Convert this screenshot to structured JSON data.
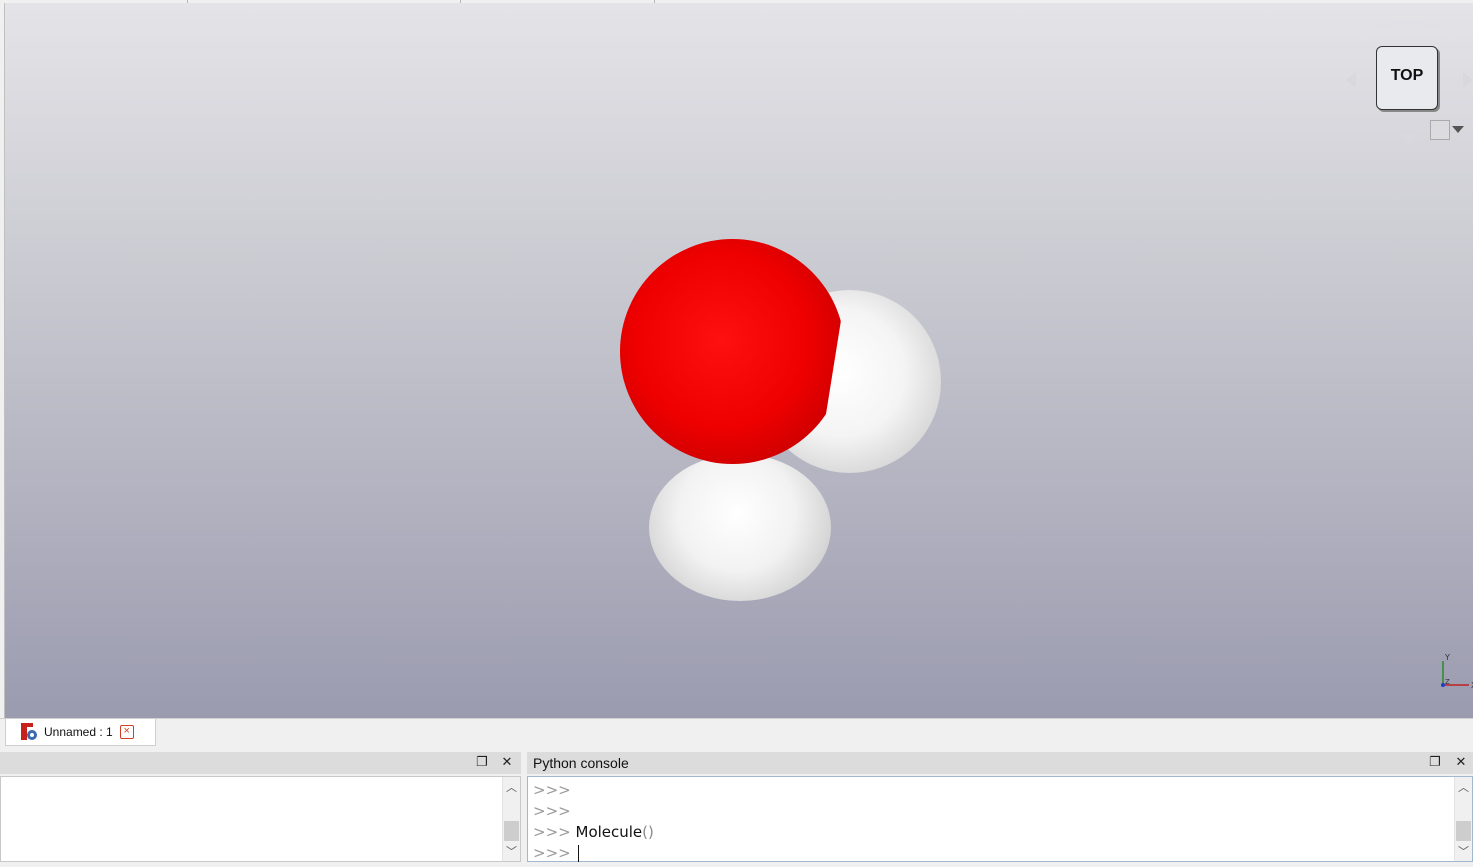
{
  "navcube": {
    "face_label": "TOP"
  },
  "axes": {
    "x_label": "X",
    "y_label": "Y",
    "z_label": "Z"
  },
  "document_tabs": [
    {
      "label": "Unnamed : 1"
    }
  ],
  "report_view": {
    "float_icon": "float-icon",
    "close_icon": "close-icon"
  },
  "python_console": {
    "title": "Python console",
    "lines": [
      {
        "prompt": ">>>",
        "code": "",
        "args": ""
      },
      {
        "prompt": ">>>",
        "code": "",
        "args": ""
      },
      {
        "prompt": ">>>",
        "code": "Molecule",
        "args": "()"
      },
      {
        "prompt": ">>>",
        "code": "",
        "args": ""
      }
    ]
  },
  "molecule": {
    "atoms": [
      {
        "element": "O",
        "color": "#ee0000"
      },
      {
        "element": "H",
        "color": "#f2f2f2"
      },
      {
        "element": "H",
        "color": "#f2f2f2"
      }
    ]
  }
}
